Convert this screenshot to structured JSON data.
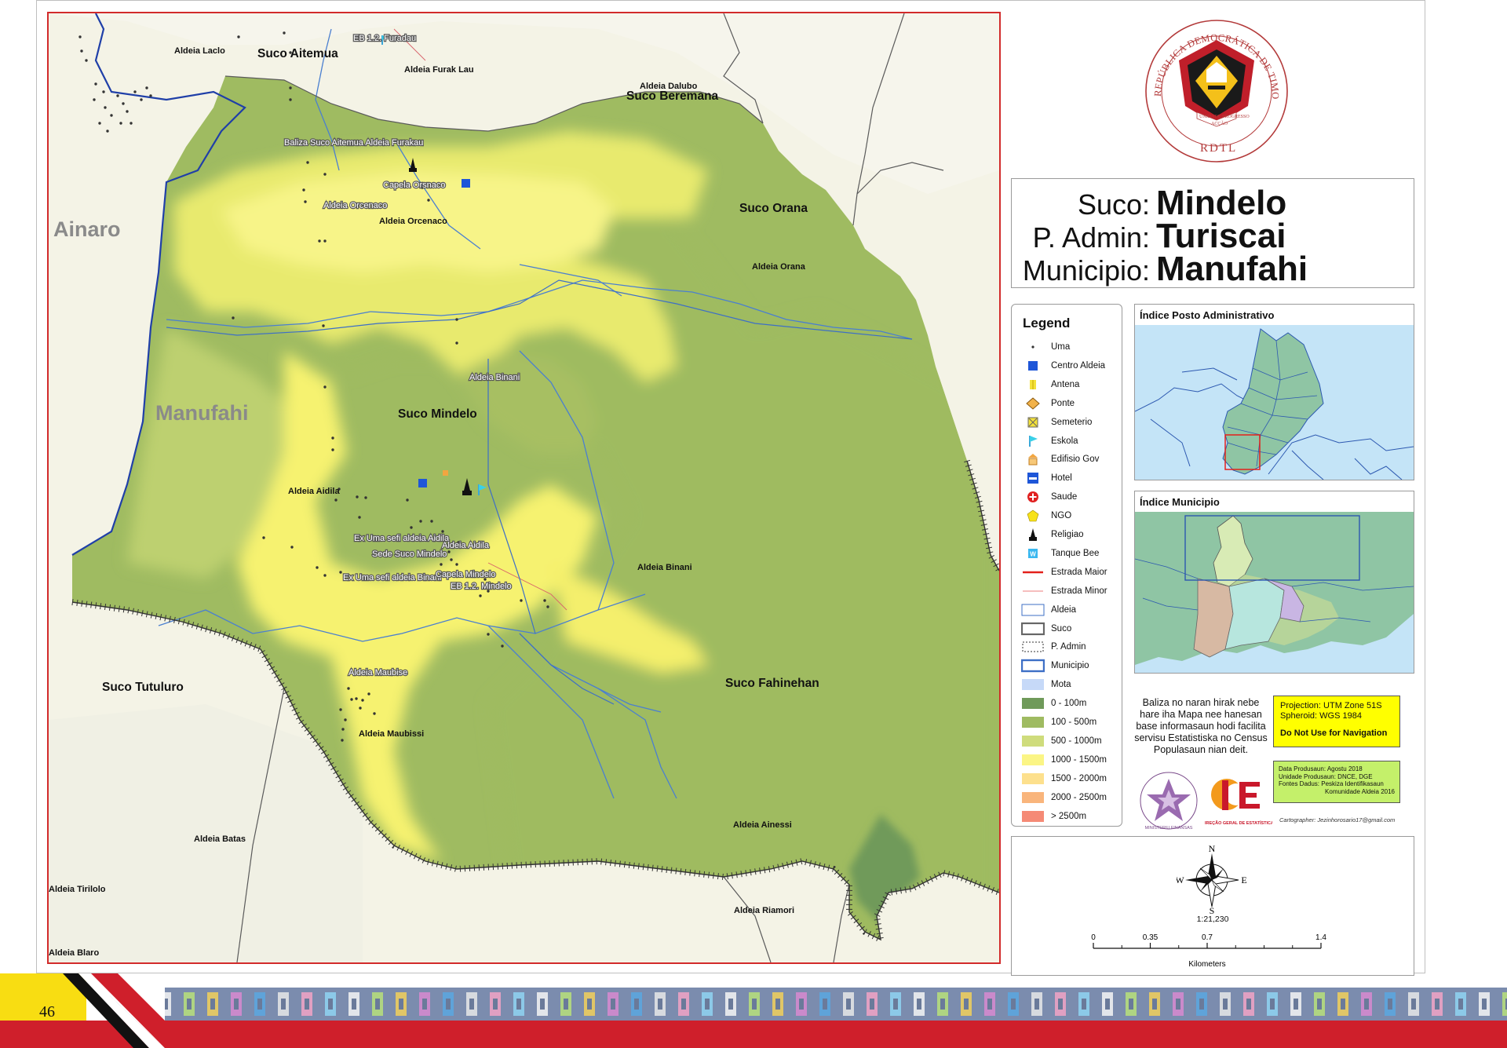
{
  "map": {
    "region_labels": {
      "ainaro": "Ainaro",
      "manufahi": "Manufahi",
      "suco_mindelo": "Suco Mindelo",
      "suco_aitemua": "Suco Aitemua",
      "suco_beremana": "Suco Beremana",
      "suco_orana": "Suco Orana",
      "suco_tutuluro": "Suco Tutuluro",
      "suco_fahinehan": "Suco Fahinehan"
    },
    "aldeia_labels": {
      "laclo": "Aldeia Laclo",
      "furak_lau": "Aldeia Furak Lau",
      "dalubo": "Aldeia Dalubo",
      "orana": "Aldeia Orana",
      "orcenaco": "Aldeia Orcenaco",
      "aidila": "Aldeia Aidila",
      "binani": "Aldeia Binani",
      "maubissi": "Aldeia Maubissi",
      "batas": "Aldeia Batas",
      "tirilolo": "Aldeia Tirilolo",
      "blaro": "Aldeia Blaro",
      "ainessi": "Aldeia Ainessi",
      "riamori": "Aldeia Riamori"
    },
    "poi_labels": {
      "eb_furadau": "EB 1.2. Furadau",
      "baliza": "Baliza Suco Aitemua Aldeia Furakau",
      "capela_orsnaco": "Capela Orsnaco",
      "aldeia_orcenaco_poi": "Aldeia Orcenaco",
      "aldeia_binani_poi": "Aldeia Binani",
      "ex_uma_aidila": "Ex Uma sefi aldeia Aidila",
      "sede_suco": "Sede Suco Mindelo",
      "aldeia_aidila_poi": "Aldeia Aidila",
      "ex_uma_binani": "Ex Uma sefi aldeia Binani",
      "capela_mindelo": "Capela Mindelo",
      "eb_mindelo": "EB 1.2. Mindelo",
      "aldeia_maubise_poi": "Aldeia Maubise"
    }
  },
  "title": {
    "suco_key": "Suco:",
    "suco_val": "Mindelo",
    "padmin_key": "P. Admin:",
    "padmin_val": "Turiscai",
    "municipio_key": "Municipio:",
    "municipio_val": "Manufahi"
  },
  "emblem": {
    "ring_text": "REPÚBLICA DEMOCRÁTICA DE TIMOR-LESTE",
    "motto_left": "UNIDADE",
    "motto_mid": "ACÇÃO",
    "motto_right": "PROGRESSO",
    "abbrev": "RDTL"
  },
  "legend": {
    "title": "Legend",
    "items": [
      {
        "label": "Uma",
        "icon": "dot-icon"
      },
      {
        "label": "Centro Aldeia",
        "icon": "blue-square-icon"
      },
      {
        "label": "Antena",
        "icon": "antenna-icon"
      },
      {
        "label": "Ponte",
        "icon": "bridge-icon"
      },
      {
        "label": "Semeterio",
        "icon": "cemetery-icon"
      },
      {
        "label": "Eskola",
        "icon": "school-flag-icon"
      },
      {
        "label": "Edifisio Gov",
        "icon": "government-building-icon"
      },
      {
        "label": "Hotel",
        "icon": "hotel-bed-icon"
      },
      {
        "label": "Saude",
        "icon": "health-cross-icon"
      },
      {
        "label": "NGO",
        "icon": "ngo-pentagon-icon"
      },
      {
        "label": "Religiao",
        "icon": "church-icon"
      },
      {
        "label": "Tanque Bee",
        "icon": "water-tank-icon"
      },
      {
        "label": "Estrada Maior",
        "icon": "major-road-icon"
      },
      {
        "label": "Estrada Minor",
        "icon": "minor-road-icon"
      },
      {
        "label": "Aldeia",
        "icon": "aldeia-boundary-icon"
      },
      {
        "label": "Suco",
        "icon": "suco-boundary-icon"
      },
      {
        "label": "P. Admin",
        "icon": "padmin-boundary-icon"
      },
      {
        "label": "Municipio",
        "icon": "municipio-boundary-icon"
      },
      {
        "label": "Mota",
        "icon": "river-icon"
      },
      {
        "label": "0 - 100m",
        "icon": "elevation-swatch-icon"
      },
      {
        "label": "100 - 500m",
        "icon": "elevation-swatch-icon"
      },
      {
        "label": "500 - 1000m",
        "icon": "elevation-swatch-icon"
      },
      {
        "label": "1000 - 1500m",
        "icon": "elevation-swatch-icon"
      },
      {
        "label": "1500 - 2000m",
        "icon": "elevation-swatch-icon"
      },
      {
        "label": "2000 - 2500m",
        "icon": "elevation-swatch-icon"
      },
      {
        "label": "> 2500m",
        "icon": "elevation-swatch-icon"
      }
    ]
  },
  "elevation_colors": [
    "#6f9a5a",
    "#9fbb61",
    "#cfdc7c",
    "#fbf585",
    "#fde08d",
    "#f9b57c",
    "#f58a76"
  ],
  "index_posto": {
    "title": "Índice Posto Administrativo"
  },
  "index_municipio": {
    "title": "Índice Municipio"
  },
  "note": {
    "text": "Baliza no naran hirak nebe hare iha Mapa nee hanesan base informasaun hodi facilita servisu Estatistiska no Census Populasaun nian deit.",
    "projection": "Projection: UTM Zone 51S",
    "spheroid": "Spheroid: WGS 1984",
    "warning": "Do Not Use for Navigation",
    "prod_date": "Data Produsaun: Agostu 2018",
    "prod_unit": "Unidade Produsaun: DNCE, DGE",
    "sources": "Fontes Dadus: Peskiza Identifikasaun",
    "sources2": "Komunidade Aldeia 2016",
    "cartographer": "Cartographer: Jezinhorosario17@gmail.com",
    "ministry_logo": "MINISTERIU FINANSAS",
    "dge_logo_text": "DIREÇÃO GERAL DE ESTATÍSTICA"
  },
  "scale": {
    "ratio": "1:21,230",
    "ticks": [
      "0",
      "0.35",
      "0.7",
      "1.4"
    ],
    "unit": "Kilometers",
    "compass": {
      "n": "N",
      "s": "S",
      "e": "E",
      "w": "W"
    }
  },
  "footer": {
    "page_number": "46"
  }
}
